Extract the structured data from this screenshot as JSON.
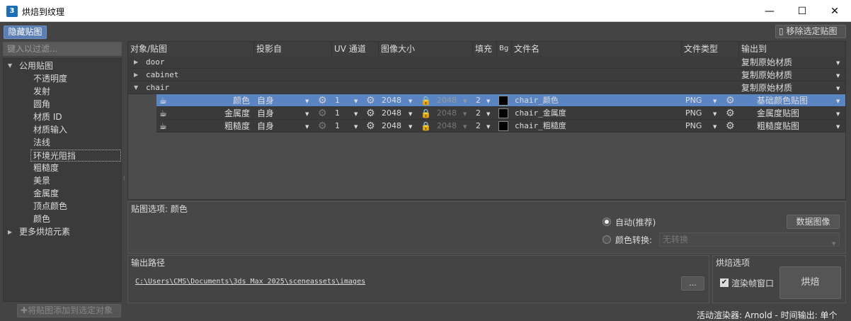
{
  "window": {
    "title": "烘焙到纹理",
    "icon_text": "3",
    "minimize": "—",
    "maximize": "☐",
    "close": "✕"
  },
  "toolbar": {
    "hide_maps": "隐藏贴图",
    "remove_maps": "移除选定贴图",
    "remove_icon": "▯"
  },
  "filter": {
    "placeholder": "键入以过滤..."
  },
  "tree": {
    "group": "公用贴图",
    "items": [
      "不透明度",
      "发射",
      "圆角",
      "材质 ID",
      "材质输入",
      "法线",
      "环境光阻挡",
      "粗糙度",
      "美景",
      "金属度",
      "顶点颜色",
      "颜色"
    ],
    "more": "更多烘焙元素"
  },
  "add_button": "将贴图添加到选定对象",
  "grid": {
    "headers": [
      "对象/贴图",
      "投影自",
      "UV 通道",
      "图像大小",
      "填充",
      "Bg",
      "文件名",
      "文件类型",
      "输出到"
    ],
    "groups": [
      {
        "name": "door",
        "output": "复制原始材质"
      },
      {
        "name": "cabinet",
        "output": "复制原始材质"
      },
      {
        "name": "chair",
        "output": "复制原始材质"
      }
    ],
    "rows": [
      {
        "map": "颜色",
        "project": "自身",
        "uv": "1",
        "size": "2048",
        "size2": "2048",
        "pad": "2",
        "file": "chair_颜色",
        "type": "PNG",
        "output": "基础颜色贴图",
        "selected": true
      },
      {
        "map": "金属度",
        "project": "自身",
        "uv": "1",
        "size": "2048",
        "size2": "2048",
        "pad": "2",
        "file": "chair_金属度",
        "type": "PNG",
        "output": "金属度贴图",
        "selected": false
      },
      {
        "map": "粗糙度",
        "project": "自身",
        "uv": "1",
        "size": "2048",
        "size2": "2048",
        "pad": "2",
        "file": "chair_粗糙度",
        "type": "PNG",
        "output": "粗糙度贴图",
        "selected": false
      }
    ]
  },
  "options": {
    "title": "贴图选项: 颜色",
    "auto": "自动(推荐)",
    "convert": "颜色转换:",
    "convert_value": "无转换",
    "data_image": "数据图像"
  },
  "output_path": {
    "label": "输出路径",
    "path": "C:\\Users\\CMS\\Documents\\3ds Max 2025\\sceneassets\\images",
    "browse": "..."
  },
  "bake": {
    "label": "烘焙选项",
    "render_frame": "渲染帧窗口",
    "bake_btn": "烘焙",
    "check": "✔"
  },
  "status": "活动渲染器: Arnold - 时间输出: 单个",
  "glyphs": {
    "tri_right": "▶",
    "tri_down": "▼",
    "dd": "▼",
    "gear": "⚙",
    "lock": "🔒",
    "teapot": "☕",
    "splitter": "⁞",
    "plus": "✚"
  }
}
